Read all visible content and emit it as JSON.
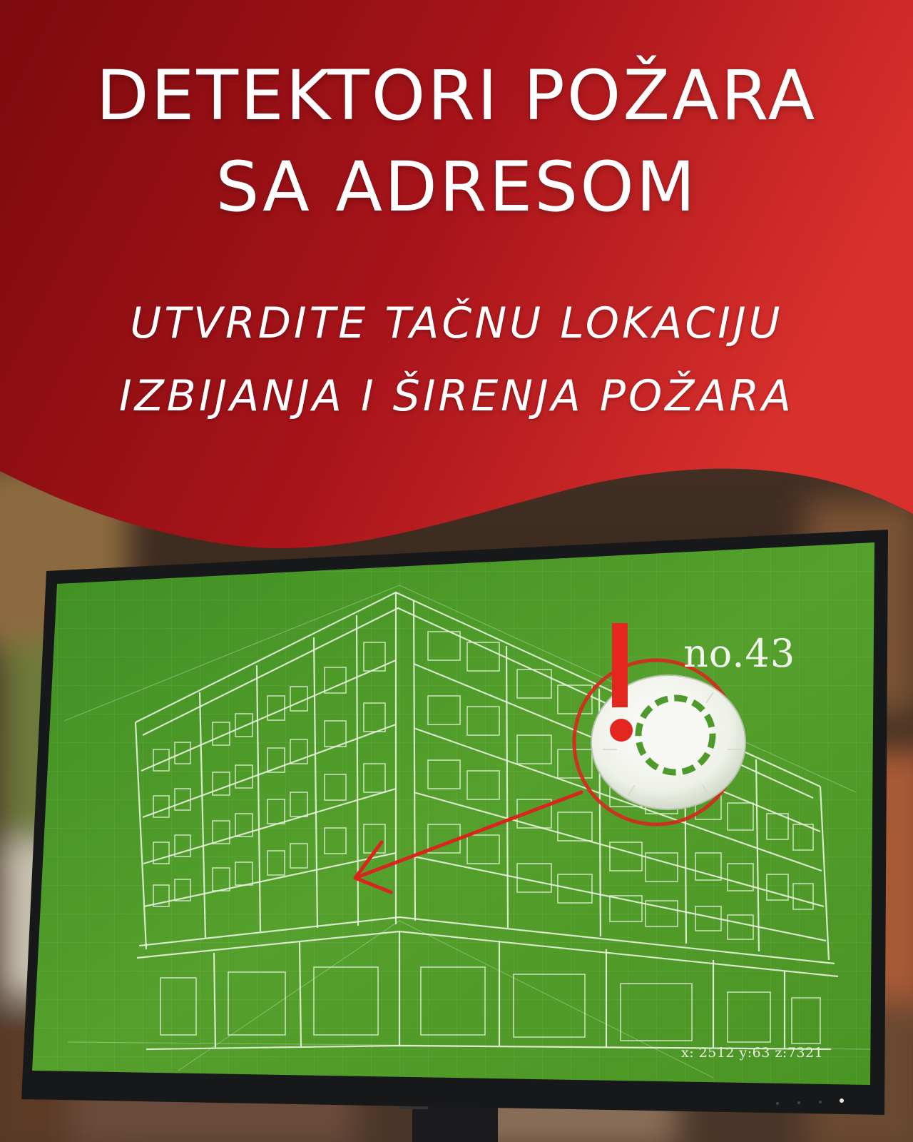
{
  "header": {
    "title_line_1": "DETEKTORI POŽARA",
    "title_line_2": "SA ADRESOM",
    "subtitle_line_1": "UTVRDITE TAČNU LOKACIJU",
    "subtitle_line_2": "IZBIJANJA I ŠIRENJA POŽARA"
  },
  "screen": {
    "detector_label": "no.43",
    "coordinates": "x: 2512  y:63  z:7321"
  },
  "colors": {
    "header_red_dark": "#7e0b0f",
    "header_red_light": "#d42a28",
    "screen_green": "#4e9a2a",
    "alert_red": "#e02020",
    "detector_white": "#f4f6f0"
  },
  "icons": {
    "alert": "exclamation-mark-icon",
    "detector": "smoke-detector-icon",
    "pointer": "arrow-icon"
  }
}
